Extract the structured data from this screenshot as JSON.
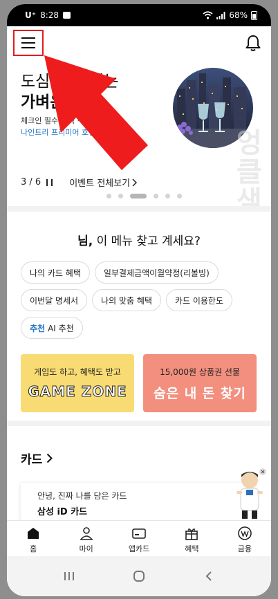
{
  "status": {
    "time": "8:28",
    "carrier": "U⁺",
    "battery": "68%"
  },
  "banner": {
    "title_line1": "도심 속 즐기는",
    "title_line2": "가벼운 휴식",
    "sub_line1": "체크인 필수 혜택 ~",
    "sub_line2": "나인트리 프리미어 호텔 가",
    "counter": "3 / 6",
    "events_link": "이벤트 전체보기",
    "watermark": "엉클샘이 전파하는 실"
  },
  "menu_section": {
    "name_suffix": "님,",
    "heading": "이 메뉴 찾고 계세요?",
    "chips": [
      "나의 카드 혜택",
      "일부결제금액이월약정(리볼빙)",
      "이번달 명세서",
      "나의 맞춤 혜택",
      "카드 이용한도"
    ],
    "ai_chip_highlight": "추천",
    "ai_chip_label": "AI 추천"
  },
  "promos": {
    "game_line1": "게임도 하고, 혜택도 받고",
    "game_line2": "GAME ZONE",
    "gift_line1": "15,000원 상품권 선물",
    "gift_line2": "숨은 내 돈 찾기"
  },
  "cards": {
    "title": "카드",
    "card_line1": "안녕, 진짜 나를 담은 카드",
    "card_line2": "삼성 iD 카드"
  },
  "bottom_nav": [
    {
      "label": "홈"
    },
    {
      "label": "마이"
    },
    {
      "label": "앱카드"
    },
    {
      "label": "혜택"
    },
    {
      "label": "금융"
    }
  ],
  "colors": {
    "highlight_red": "#e21b1b",
    "link_blue": "#1f73c7",
    "game_yellow": "#f8dc73",
    "gift_salmon": "#f38f7f"
  }
}
